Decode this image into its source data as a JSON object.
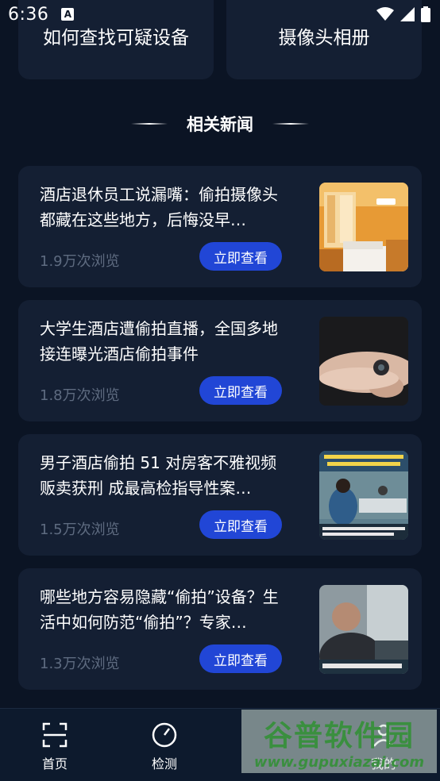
{
  "status": {
    "time": "6:36"
  },
  "top_cards": [
    {
      "label": "如何查找可疑设备"
    },
    {
      "label": "摄像头相册"
    }
  ],
  "section": {
    "title": "相关新闻"
  },
  "news": [
    {
      "title": "酒店退休员工说漏嘴：偷拍摄像头都藏在这些地方，后悔没早…",
      "views": "1.9万次浏览",
      "button": "立即查看"
    },
    {
      "title": "大学生酒店遭偷拍直播，全国多地接连曝光酒店偷拍事件",
      "views": "1.8万次浏览",
      "button": "立即查看"
    },
    {
      "title": "男子酒店偷拍 51 对房客不雅视频贩卖获刑 成最高检指导性案…",
      "views": "1.5万次浏览",
      "button": "立即查看"
    },
    {
      "title": "哪些地方容易隐藏“偷拍”设备？生活中如何防范“偷拍”？专家…",
      "views": "1.3万次浏览",
      "button": "立即查看"
    }
  ],
  "tabbar": {
    "items": [
      {
        "label": "首页",
        "icon": "scan-icon"
      },
      {
        "label": "检测",
        "icon": "gauge-icon"
      },
      {
        "label": "",
        "icon": ""
      },
      {
        "label": "我的",
        "icon": "user-icon"
      }
    ]
  },
  "watermark": {
    "line1": "谷普软件园",
    "line2": "www.gupuxiazai.com"
  },
  "colors": {
    "background": "#0b1424",
    "card": "#141f33",
    "accent": "#2146d6"
  }
}
